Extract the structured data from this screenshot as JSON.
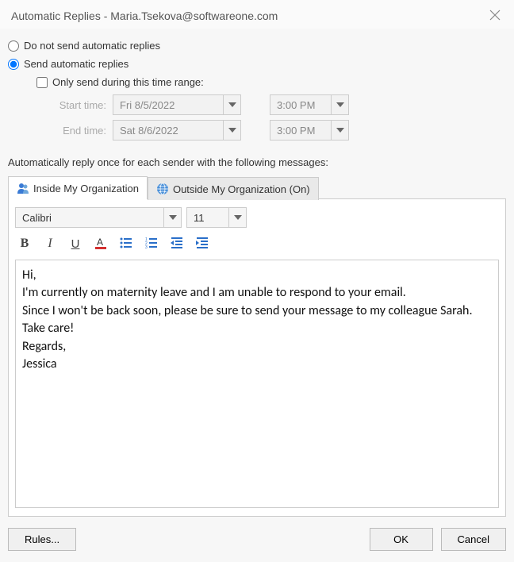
{
  "title": "Automatic Replies - Maria.Tsekova@softwareone.com",
  "radios": {
    "dont_send": "Do not send automatic replies",
    "send": "Send automatic replies"
  },
  "check_only_send": "Only send during this time range:",
  "time_labels": {
    "start": "Start time:",
    "end": "End time:"
  },
  "start_date": "Fri 8/5/2022",
  "start_time": "3:00 PM",
  "end_date": "Sat 8/6/2022",
  "end_time": "3:00 PM",
  "info_text": "Automatically reply once for each sender with the following messages:",
  "tabs": {
    "inside": "Inside My Organization",
    "outside": "Outside My Organization (On)"
  },
  "font_name": "Calibri",
  "font_size": "11",
  "message": "Hi,\nI'm currently on maternity leave and I am unable to respond to your email.\nSince I won't be back soon, please be sure to send your message to my colleague Sarah.\nTake care!\nRegards,\nJessica",
  "buttons": {
    "rules": "Rules...",
    "ok": "OK",
    "cancel": "Cancel"
  }
}
